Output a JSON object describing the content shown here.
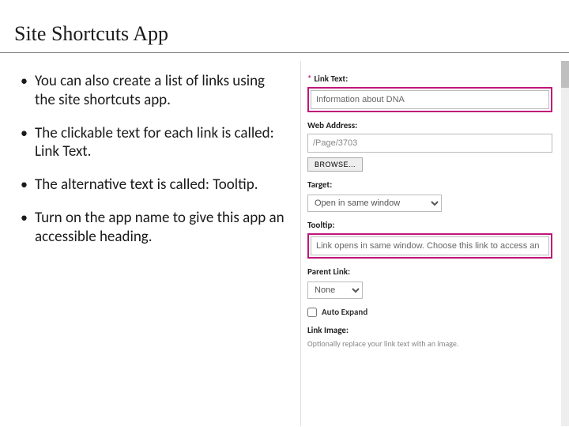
{
  "title": "Site Shortcuts App",
  "bullets": [
    "You can also create a list of links using the site shortcuts app.",
    "The clickable text for each link is called: Link Text.",
    "The alternative text is called: Tooltip.",
    "Turn on the app name to give this app an accessible heading."
  ],
  "form": {
    "link_text_label": "Link Text:",
    "link_text_value": "Information about DNA",
    "web_label": "Web Address:",
    "web_value": "/Page/3703",
    "browse_btn": "BROWSE...",
    "target_label": "Target:",
    "target_value": "Open in same window",
    "tooltip_label": "Tooltip:",
    "tooltip_value": "Link opens in same window. Choose this link to access an",
    "parent_label": "Parent Link:",
    "parent_value": "None",
    "auto_expand_label": "Auto Expand",
    "image_label": "Link Image:",
    "image_help": "Optionally replace your link text with an image."
  }
}
